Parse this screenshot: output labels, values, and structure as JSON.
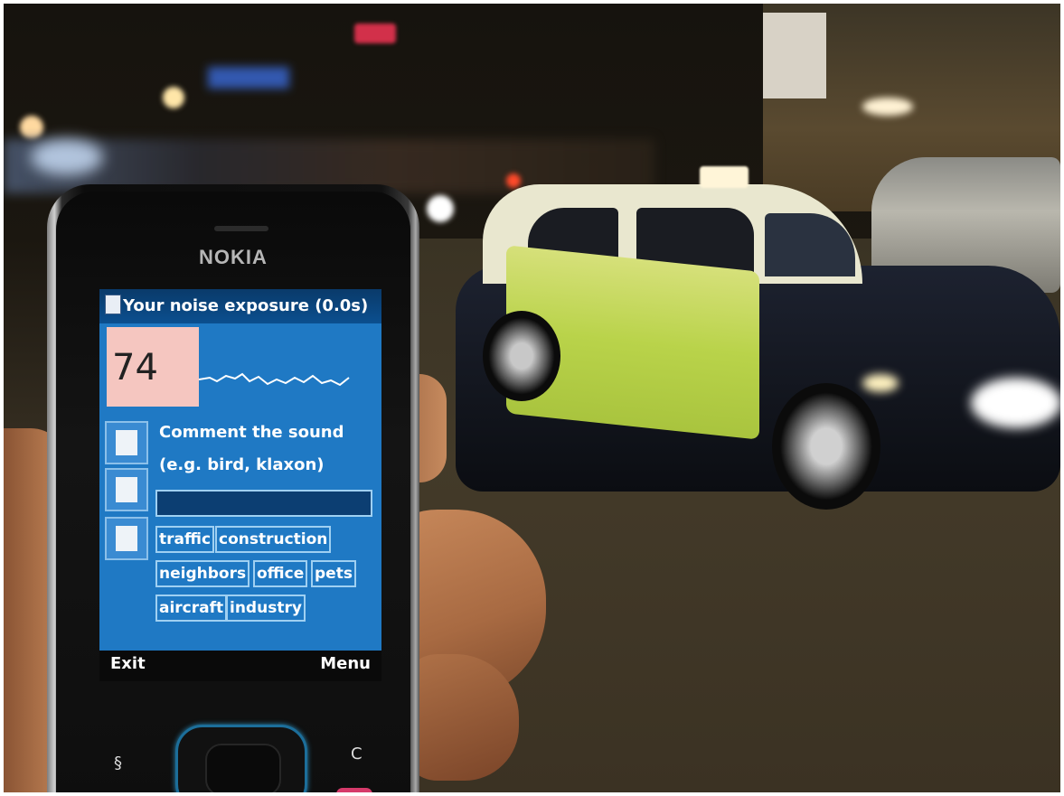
{
  "phone": {
    "brand": "NOKIA",
    "app": {
      "title": "Your noise exposure (0.0s)",
      "noise_level": "74",
      "prompt_line1": "Comment the sound",
      "prompt_line2": "(e.g. bird, klaxon)",
      "comment_value": "",
      "tags": [
        "traffic",
        "construction",
        "neighbors",
        "office",
        "pets",
        "aircraft",
        "industry"
      ],
      "softkey_left": "Exit",
      "softkey_right": "Menu"
    },
    "keys": {
      "left": "§",
      "right": "C"
    }
  },
  "colors": {
    "screen_bg": "#1f79c4",
    "level_box": "#f5c6c0",
    "taxi_body": "#e9e7cf",
    "taxi_stripe": "#b9d34a"
  }
}
